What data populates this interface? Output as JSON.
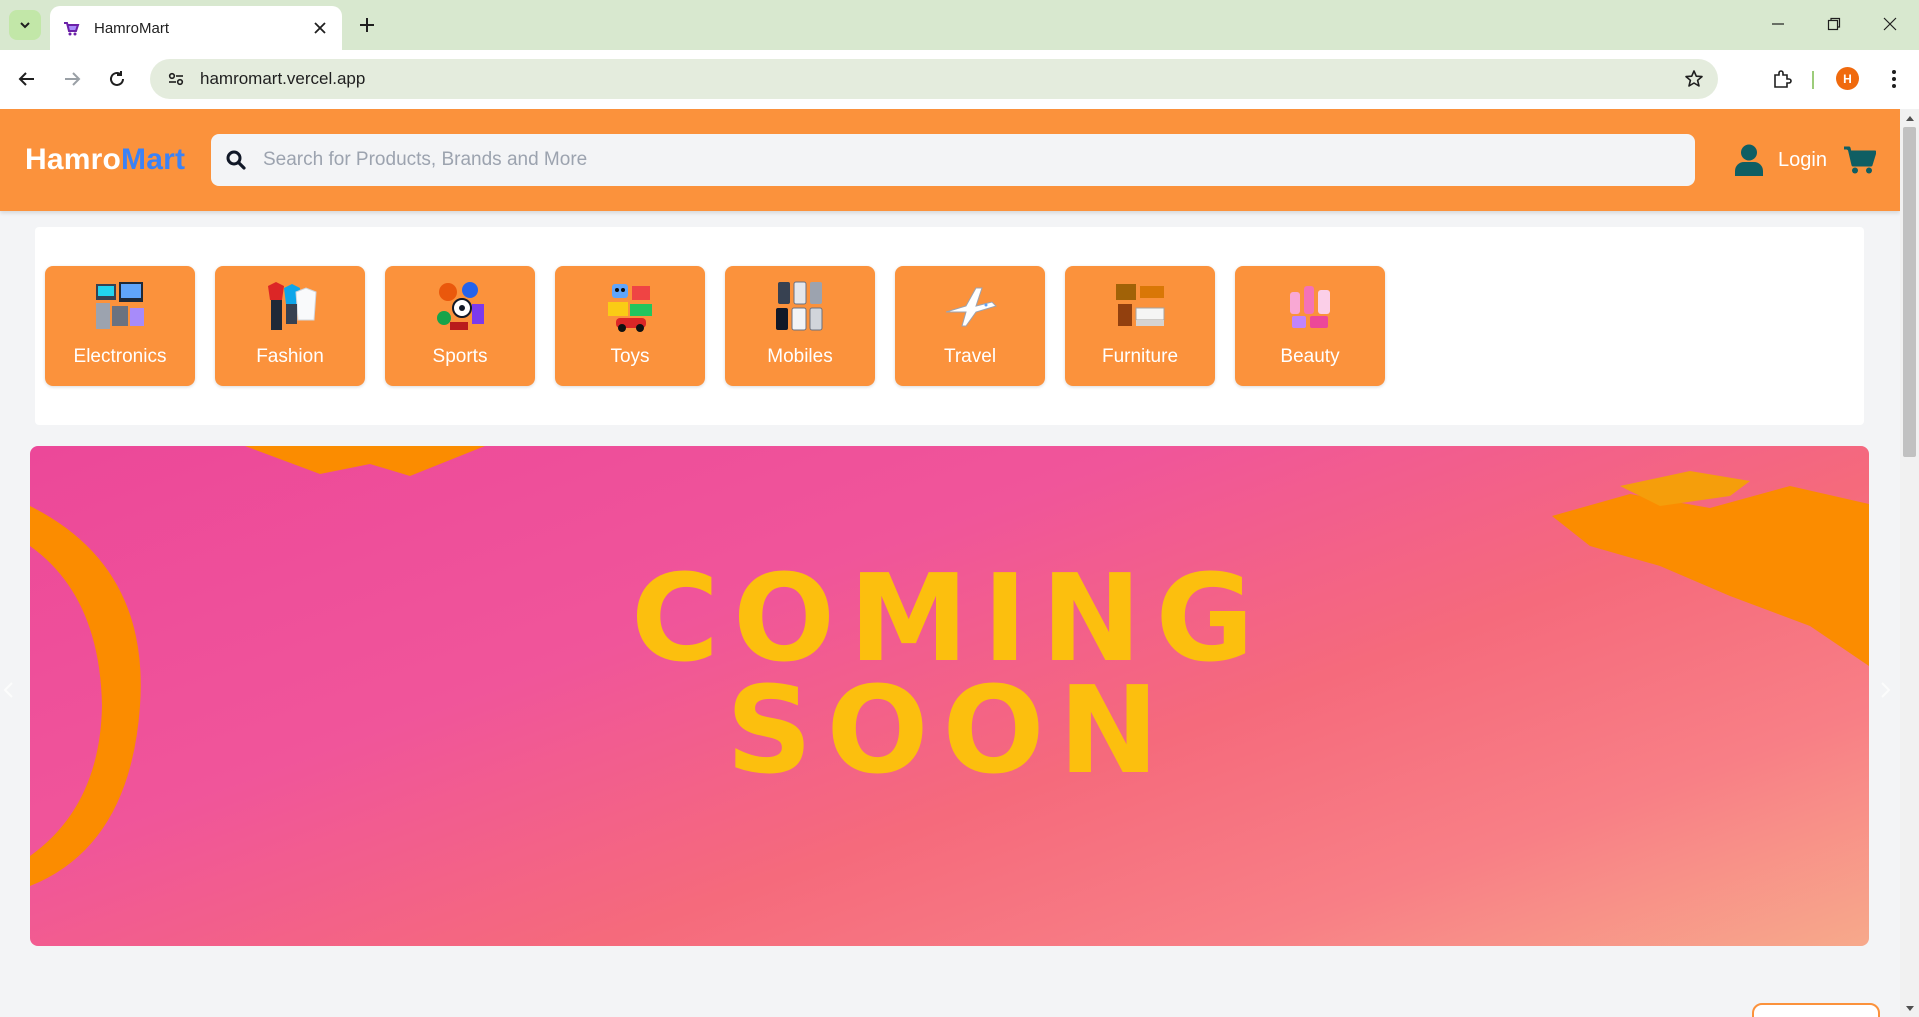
{
  "browser": {
    "tab_title": "HamroMart",
    "url": "hamromart.vercel.app",
    "profile_initial": "H"
  },
  "header": {
    "logo_part1": "Hamro",
    "logo_part2": "Mart",
    "search_placeholder": "Search for Products, Brands and More",
    "login_label": "Login"
  },
  "categories": [
    {
      "label": "Electronics",
      "icon": "electronics-icon"
    },
    {
      "label": "Fashion",
      "icon": "fashion-icon"
    },
    {
      "label": "Sports",
      "icon": "sports-icon"
    },
    {
      "label": "Toys",
      "icon": "toys-icon"
    },
    {
      "label": "Mobiles",
      "icon": "mobiles-icon"
    },
    {
      "label": "Travel",
      "icon": "airplane-icon"
    },
    {
      "label": "Furniture",
      "icon": "furniture-icon"
    },
    {
      "label": "Beauty",
      "icon": "beauty-icon"
    }
  ],
  "banner": {
    "line1": "COMING",
    "line2": "SOON"
  },
  "colors": {
    "header_bg": "#fb923c",
    "logo_accent": "#3b82f6",
    "banner_text": "#fcbf0e",
    "icon_teal": "#0f5e63"
  }
}
